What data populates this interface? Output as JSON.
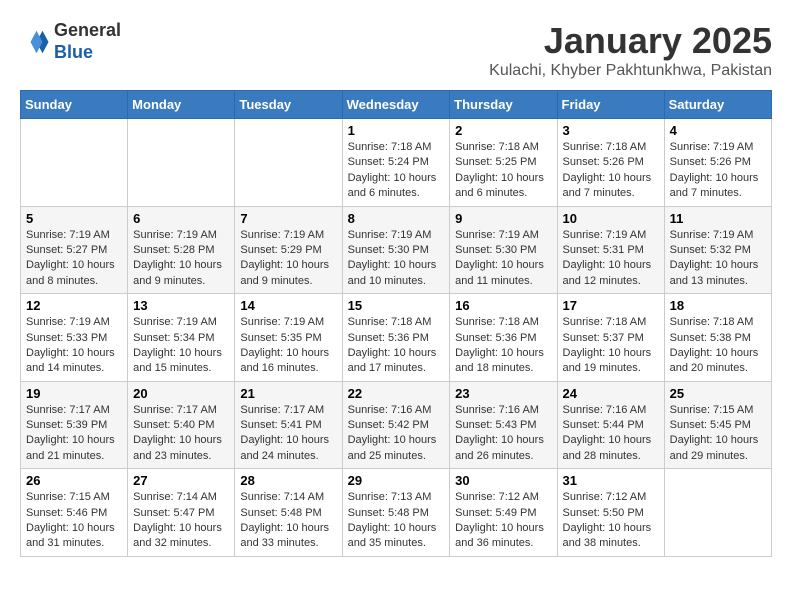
{
  "header": {
    "logo_general": "General",
    "logo_blue": "Blue",
    "month_title": "January 2025",
    "subtitle": "Kulachi, Khyber Pakhtunkhwa, Pakistan"
  },
  "days_of_week": [
    "Sunday",
    "Monday",
    "Tuesday",
    "Wednesday",
    "Thursday",
    "Friday",
    "Saturday"
  ],
  "weeks": [
    [
      {
        "day": "",
        "info": ""
      },
      {
        "day": "",
        "info": ""
      },
      {
        "day": "",
        "info": ""
      },
      {
        "day": "1",
        "info": "Sunrise: 7:18 AM\nSunset: 5:24 PM\nDaylight: 10 hours and 6 minutes."
      },
      {
        "day": "2",
        "info": "Sunrise: 7:18 AM\nSunset: 5:25 PM\nDaylight: 10 hours and 6 minutes."
      },
      {
        "day": "3",
        "info": "Sunrise: 7:18 AM\nSunset: 5:26 PM\nDaylight: 10 hours and 7 minutes."
      },
      {
        "day": "4",
        "info": "Sunrise: 7:19 AM\nSunset: 5:26 PM\nDaylight: 10 hours and 7 minutes."
      }
    ],
    [
      {
        "day": "5",
        "info": "Sunrise: 7:19 AM\nSunset: 5:27 PM\nDaylight: 10 hours and 8 minutes."
      },
      {
        "day": "6",
        "info": "Sunrise: 7:19 AM\nSunset: 5:28 PM\nDaylight: 10 hours and 9 minutes."
      },
      {
        "day": "7",
        "info": "Sunrise: 7:19 AM\nSunset: 5:29 PM\nDaylight: 10 hours and 9 minutes."
      },
      {
        "day": "8",
        "info": "Sunrise: 7:19 AM\nSunset: 5:30 PM\nDaylight: 10 hours and 10 minutes."
      },
      {
        "day": "9",
        "info": "Sunrise: 7:19 AM\nSunset: 5:30 PM\nDaylight: 10 hours and 11 minutes."
      },
      {
        "day": "10",
        "info": "Sunrise: 7:19 AM\nSunset: 5:31 PM\nDaylight: 10 hours and 12 minutes."
      },
      {
        "day": "11",
        "info": "Sunrise: 7:19 AM\nSunset: 5:32 PM\nDaylight: 10 hours and 13 minutes."
      }
    ],
    [
      {
        "day": "12",
        "info": "Sunrise: 7:19 AM\nSunset: 5:33 PM\nDaylight: 10 hours and 14 minutes."
      },
      {
        "day": "13",
        "info": "Sunrise: 7:19 AM\nSunset: 5:34 PM\nDaylight: 10 hours and 15 minutes."
      },
      {
        "day": "14",
        "info": "Sunrise: 7:19 AM\nSunset: 5:35 PM\nDaylight: 10 hours and 16 minutes."
      },
      {
        "day": "15",
        "info": "Sunrise: 7:18 AM\nSunset: 5:36 PM\nDaylight: 10 hours and 17 minutes."
      },
      {
        "day": "16",
        "info": "Sunrise: 7:18 AM\nSunset: 5:36 PM\nDaylight: 10 hours and 18 minutes."
      },
      {
        "day": "17",
        "info": "Sunrise: 7:18 AM\nSunset: 5:37 PM\nDaylight: 10 hours and 19 minutes."
      },
      {
        "day": "18",
        "info": "Sunrise: 7:18 AM\nSunset: 5:38 PM\nDaylight: 10 hours and 20 minutes."
      }
    ],
    [
      {
        "day": "19",
        "info": "Sunrise: 7:17 AM\nSunset: 5:39 PM\nDaylight: 10 hours and 21 minutes."
      },
      {
        "day": "20",
        "info": "Sunrise: 7:17 AM\nSunset: 5:40 PM\nDaylight: 10 hours and 23 minutes."
      },
      {
        "day": "21",
        "info": "Sunrise: 7:17 AM\nSunset: 5:41 PM\nDaylight: 10 hours and 24 minutes."
      },
      {
        "day": "22",
        "info": "Sunrise: 7:16 AM\nSunset: 5:42 PM\nDaylight: 10 hours and 25 minutes."
      },
      {
        "day": "23",
        "info": "Sunrise: 7:16 AM\nSunset: 5:43 PM\nDaylight: 10 hours and 26 minutes."
      },
      {
        "day": "24",
        "info": "Sunrise: 7:16 AM\nSunset: 5:44 PM\nDaylight: 10 hours and 28 minutes."
      },
      {
        "day": "25",
        "info": "Sunrise: 7:15 AM\nSunset: 5:45 PM\nDaylight: 10 hours and 29 minutes."
      }
    ],
    [
      {
        "day": "26",
        "info": "Sunrise: 7:15 AM\nSunset: 5:46 PM\nDaylight: 10 hours and 31 minutes."
      },
      {
        "day": "27",
        "info": "Sunrise: 7:14 AM\nSunset: 5:47 PM\nDaylight: 10 hours and 32 minutes."
      },
      {
        "day": "28",
        "info": "Sunrise: 7:14 AM\nSunset: 5:48 PM\nDaylight: 10 hours and 33 minutes."
      },
      {
        "day": "29",
        "info": "Sunrise: 7:13 AM\nSunset: 5:48 PM\nDaylight: 10 hours and 35 minutes."
      },
      {
        "day": "30",
        "info": "Sunrise: 7:12 AM\nSunset: 5:49 PM\nDaylight: 10 hours and 36 minutes."
      },
      {
        "day": "31",
        "info": "Sunrise: 7:12 AM\nSunset: 5:50 PM\nDaylight: 10 hours and 38 minutes."
      },
      {
        "day": "",
        "info": ""
      }
    ]
  ]
}
